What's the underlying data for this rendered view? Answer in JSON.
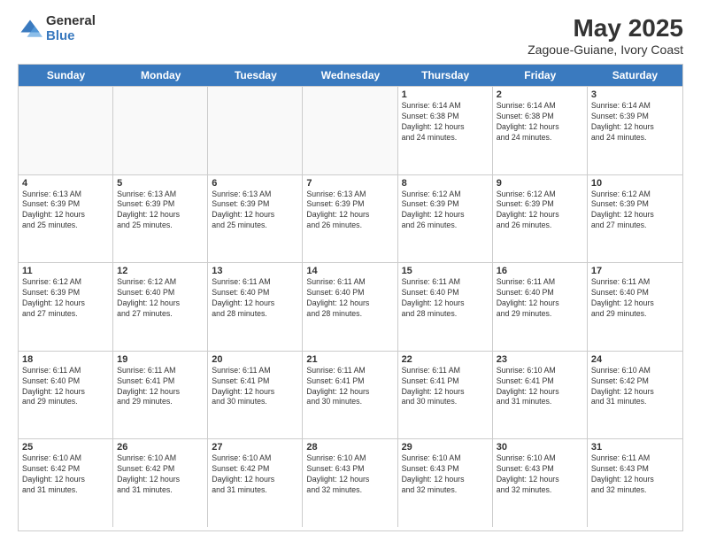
{
  "logo": {
    "general": "General",
    "blue": "Blue"
  },
  "title": "May 2025",
  "location": "Zagoue-Guiane, Ivory Coast",
  "days": [
    "Sunday",
    "Monday",
    "Tuesday",
    "Wednesday",
    "Thursday",
    "Friday",
    "Saturday"
  ],
  "weeks": [
    [
      {
        "num": "",
        "info": ""
      },
      {
        "num": "",
        "info": ""
      },
      {
        "num": "",
        "info": ""
      },
      {
        "num": "",
        "info": ""
      },
      {
        "num": "1",
        "info": "Sunrise: 6:14 AM\nSunset: 6:38 PM\nDaylight: 12 hours\nand 24 minutes."
      },
      {
        "num": "2",
        "info": "Sunrise: 6:14 AM\nSunset: 6:38 PM\nDaylight: 12 hours\nand 24 minutes."
      },
      {
        "num": "3",
        "info": "Sunrise: 6:14 AM\nSunset: 6:39 PM\nDaylight: 12 hours\nand 24 minutes."
      }
    ],
    [
      {
        "num": "4",
        "info": "Sunrise: 6:13 AM\nSunset: 6:39 PM\nDaylight: 12 hours\nand 25 minutes."
      },
      {
        "num": "5",
        "info": "Sunrise: 6:13 AM\nSunset: 6:39 PM\nDaylight: 12 hours\nand 25 minutes."
      },
      {
        "num": "6",
        "info": "Sunrise: 6:13 AM\nSunset: 6:39 PM\nDaylight: 12 hours\nand 25 minutes."
      },
      {
        "num": "7",
        "info": "Sunrise: 6:13 AM\nSunset: 6:39 PM\nDaylight: 12 hours\nand 26 minutes."
      },
      {
        "num": "8",
        "info": "Sunrise: 6:12 AM\nSunset: 6:39 PM\nDaylight: 12 hours\nand 26 minutes."
      },
      {
        "num": "9",
        "info": "Sunrise: 6:12 AM\nSunset: 6:39 PM\nDaylight: 12 hours\nand 26 minutes."
      },
      {
        "num": "10",
        "info": "Sunrise: 6:12 AM\nSunset: 6:39 PM\nDaylight: 12 hours\nand 27 minutes."
      }
    ],
    [
      {
        "num": "11",
        "info": "Sunrise: 6:12 AM\nSunset: 6:39 PM\nDaylight: 12 hours\nand 27 minutes."
      },
      {
        "num": "12",
        "info": "Sunrise: 6:12 AM\nSunset: 6:40 PM\nDaylight: 12 hours\nand 27 minutes."
      },
      {
        "num": "13",
        "info": "Sunrise: 6:11 AM\nSunset: 6:40 PM\nDaylight: 12 hours\nand 28 minutes."
      },
      {
        "num": "14",
        "info": "Sunrise: 6:11 AM\nSunset: 6:40 PM\nDaylight: 12 hours\nand 28 minutes."
      },
      {
        "num": "15",
        "info": "Sunrise: 6:11 AM\nSunset: 6:40 PM\nDaylight: 12 hours\nand 28 minutes."
      },
      {
        "num": "16",
        "info": "Sunrise: 6:11 AM\nSunset: 6:40 PM\nDaylight: 12 hours\nand 29 minutes."
      },
      {
        "num": "17",
        "info": "Sunrise: 6:11 AM\nSunset: 6:40 PM\nDaylight: 12 hours\nand 29 minutes."
      }
    ],
    [
      {
        "num": "18",
        "info": "Sunrise: 6:11 AM\nSunset: 6:40 PM\nDaylight: 12 hours\nand 29 minutes."
      },
      {
        "num": "19",
        "info": "Sunrise: 6:11 AM\nSunset: 6:41 PM\nDaylight: 12 hours\nand 29 minutes."
      },
      {
        "num": "20",
        "info": "Sunrise: 6:11 AM\nSunset: 6:41 PM\nDaylight: 12 hours\nand 30 minutes."
      },
      {
        "num": "21",
        "info": "Sunrise: 6:11 AM\nSunset: 6:41 PM\nDaylight: 12 hours\nand 30 minutes."
      },
      {
        "num": "22",
        "info": "Sunrise: 6:11 AM\nSunset: 6:41 PM\nDaylight: 12 hours\nand 30 minutes."
      },
      {
        "num": "23",
        "info": "Sunrise: 6:10 AM\nSunset: 6:41 PM\nDaylight: 12 hours\nand 31 minutes."
      },
      {
        "num": "24",
        "info": "Sunrise: 6:10 AM\nSunset: 6:42 PM\nDaylight: 12 hours\nand 31 minutes."
      }
    ],
    [
      {
        "num": "25",
        "info": "Sunrise: 6:10 AM\nSunset: 6:42 PM\nDaylight: 12 hours\nand 31 minutes."
      },
      {
        "num": "26",
        "info": "Sunrise: 6:10 AM\nSunset: 6:42 PM\nDaylight: 12 hours\nand 31 minutes."
      },
      {
        "num": "27",
        "info": "Sunrise: 6:10 AM\nSunset: 6:42 PM\nDaylight: 12 hours\nand 31 minutes."
      },
      {
        "num": "28",
        "info": "Sunrise: 6:10 AM\nSunset: 6:43 PM\nDaylight: 12 hours\nand 32 minutes."
      },
      {
        "num": "29",
        "info": "Sunrise: 6:10 AM\nSunset: 6:43 PM\nDaylight: 12 hours\nand 32 minutes."
      },
      {
        "num": "30",
        "info": "Sunrise: 6:10 AM\nSunset: 6:43 PM\nDaylight: 12 hours\nand 32 minutes."
      },
      {
        "num": "31",
        "info": "Sunrise: 6:11 AM\nSunset: 6:43 PM\nDaylight: 12 hours\nand 32 minutes."
      }
    ]
  ]
}
